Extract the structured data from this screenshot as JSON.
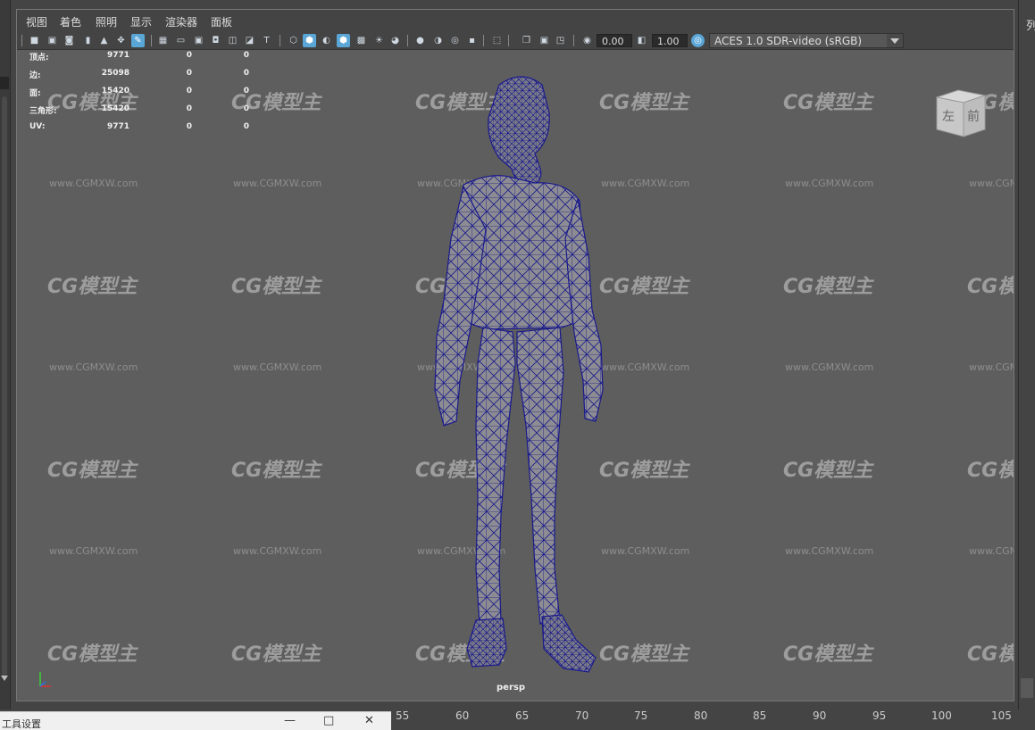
{
  "menu": [
    "视图",
    "着色",
    "照明",
    "显示",
    "渲染器",
    "面板"
  ],
  "toolbar": {
    "exposure": "0.00",
    "gamma": "1.00",
    "color_space": "ACES 1.0 SDR-video (sRGB)"
  },
  "hud": {
    "rows": [
      {
        "label": "顶点:",
        "v1": "9771",
        "v2": "0",
        "v3": "0"
      },
      {
        "label": "边:",
        "v1": "25098",
        "v2": "0",
        "v3": "0"
      },
      {
        "label": "面:",
        "v1": "15420",
        "v2": "0",
        "v3": "0"
      },
      {
        "label": "三角形:",
        "v1": "15420",
        "v2": "0",
        "v3": "0"
      },
      {
        "label": "UV:",
        "v1": "9771",
        "v2": "0",
        "v3": "0"
      }
    ]
  },
  "viewcube": {
    "left_face": "左",
    "front_face": "前"
  },
  "camera_label": "persp",
  "watermark": {
    "logo": "CG模型主",
    "url": "www.CGMXW.com"
  },
  "right_panel_title": "列",
  "tool_window": {
    "title": "工具设置"
  },
  "timeline": {
    "ticks": [
      "55",
      "60",
      "65",
      "70",
      "75",
      "80",
      "85",
      "90",
      "95",
      "100",
      "105"
    ]
  },
  "colors": {
    "wireframe": "#1a1a8c",
    "mesh_fill": "#8a8a90",
    "viewport_bg": "#5e5e5e",
    "active_icon": "#5aa6d6"
  }
}
